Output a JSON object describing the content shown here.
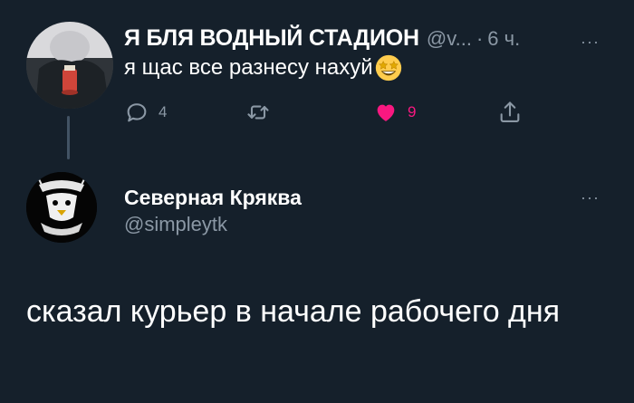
{
  "parent_tweet": {
    "display_name": "Я БЛЯ ВОДНЫЙ СТАДИОН",
    "handle": "@v...",
    "separator": "·",
    "time": "6 ч.",
    "text": "я щас все разнесу нахуй",
    "emoji": "star-struck-emoji",
    "actions": {
      "reply_count": "4",
      "retweet_count": "",
      "like_count": "9",
      "liked": true
    },
    "more_label": "···"
  },
  "main_tweet": {
    "display_name": "Северная Кряква",
    "handle": "@simpleytk",
    "text": "сказал курьер в начале рабочего дня",
    "more_label": "···"
  },
  "colors": {
    "background": "#15202b",
    "text": "#ffffff",
    "secondary": "#8b98a5",
    "like": "#f91880",
    "thread_line": "#425364"
  }
}
